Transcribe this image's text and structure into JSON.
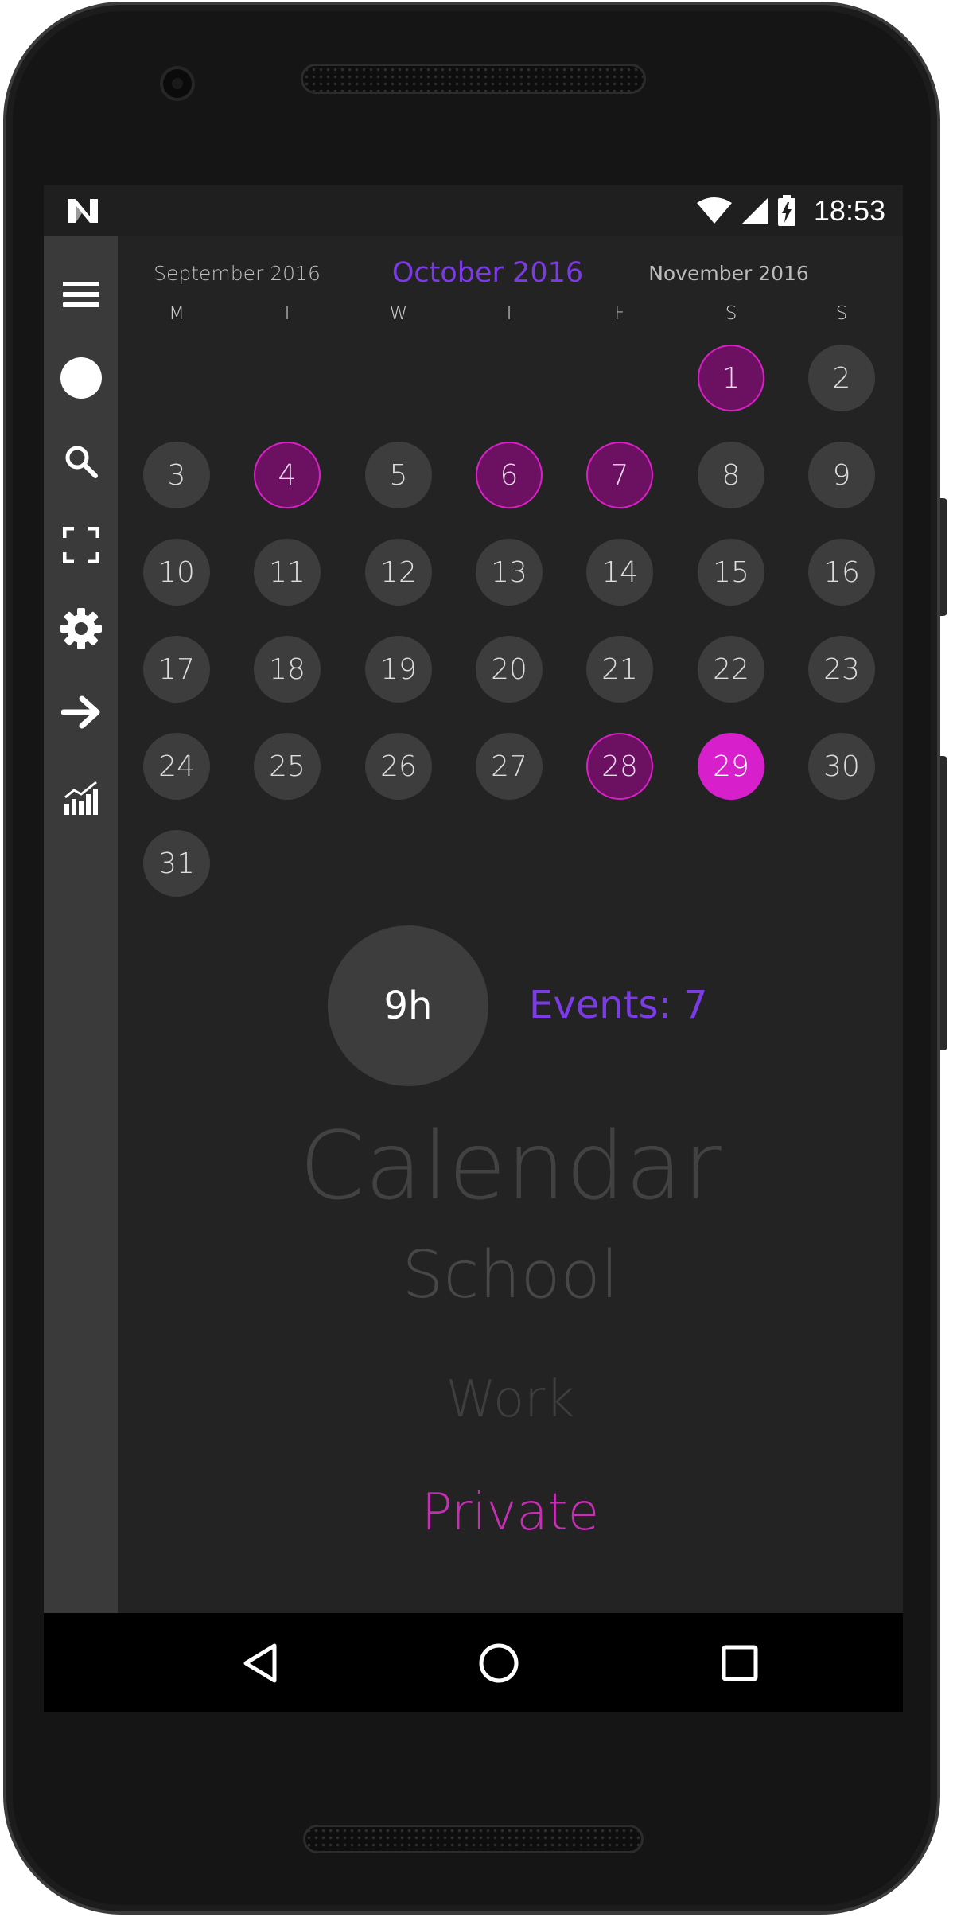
{
  "status_bar": {
    "time": "18:53",
    "icons": [
      "n-logo-icon",
      "wifi-icon",
      "signal-icon",
      "battery-charging-icon"
    ]
  },
  "side_rail": {
    "items": [
      {
        "icon": "menu-icon"
      },
      {
        "icon": "circle-icon"
      },
      {
        "icon": "search-icon"
      },
      {
        "icon": "fullscreen-icon"
      },
      {
        "icon": "gear-icon"
      },
      {
        "icon": "arrow-right-icon"
      },
      {
        "icon": "chart-icon"
      }
    ]
  },
  "calendar": {
    "prev_month": "September 2016",
    "current_month": "October 2016",
    "next_month": "November 2016",
    "weekdays": [
      "M",
      "T",
      "W",
      "T",
      "F",
      "S",
      "S"
    ],
    "days": [
      {
        "n": "1",
        "state": "event"
      },
      {
        "n": "2",
        "state": "normal"
      },
      {
        "n": "3",
        "state": "normal"
      },
      {
        "n": "4",
        "state": "event"
      },
      {
        "n": "5",
        "state": "normal"
      },
      {
        "n": "6",
        "state": "event"
      },
      {
        "n": "7",
        "state": "event"
      },
      {
        "n": "8",
        "state": "normal"
      },
      {
        "n": "9",
        "state": "normal"
      },
      {
        "n": "10",
        "state": "normal"
      },
      {
        "n": "11",
        "state": "normal"
      },
      {
        "n": "12",
        "state": "normal"
      },
      {
        "n": "13",
        "state": "normal"
      },
      {
        "n": "14",
        "state": "normal"
      },
      {
        "n": "15",
        "state": "normal"
      },
      {
        "n": "16",
        "state": "normal"
      },
      {
        "n": "17",
        "state": "normal"
      },
      {
        "n": "18",
        "state": "normal"
      },
      {
        "n": "19",
        "state": "normal"
      },
      {
        "n": "20",
        "state": "normal"
      },
      {
        "n": "21",
        "state": "normal"
      },
      {
        "n": "22",
        "state": "normal"
      },
      {
        "n": "23",
        "state": "normal"
      },
      {
        "n": "24",
        "state": "normal"
      },
      {
        "n": "25",
        "state": "normal"
      },
      {
        "n": "26",
        "state": "normal"
      },
      {
        "n": "27",
        "state": "normal"
      },
      {
        "n": "28",
        "state": "event"
      },
      {
        "n": "29",
        "state": "today"
      },
      {
        "n": "30",
        "state": "normal"
      },
      {
        "n": "31",
        "state": "normal"
      }
    ]
  },
  "summary": {
    "hours": "9h",
    "events": "Events: 7"
  },
  "categories": {
    "calendar": "Calendar",
    "school": "School",
    "work": "Work",
    "private": "Private"
  },
  "colors": {
    "accent_purple": "#7c3ae6",
    "event_fill": "#6c1061",
    "today_fill": "#d81fcc",
    "private_text": "#c330b4"
  },
  "nav_bar": {
    "icons": [
      "back-icon",
      "home-icon",
      "recents-icon"
    ]
  }
}
